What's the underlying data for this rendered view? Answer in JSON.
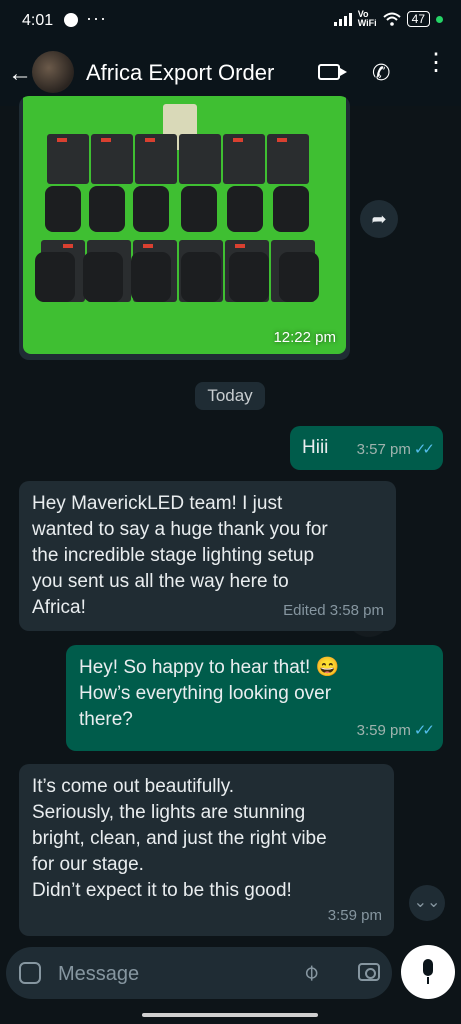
{
  "status_bar": {
    "time": "4:01",
    "dots": "···",
    "vowifi": "Vo\nWiFi",
    "battery": "47"
  },
  "header": {
    "title": "Africa Export Order"
  },
  "image_message": {
    "time": "12:22 pm"
  },
  "date_chip": "Today",
  "messages": [
    {
      "dir": "out",
      "text": "Hiii",
      "time": "3:57 pm"
    },
    {
      "dir": "in",
      "text": "Hey MaverickLED team! I just\nwanted to say a huge thank you for\nthe incredible stage lighting setup\nyou sent us  all the way here to\nAfrica!",
      "time": "Edited 3:58 pm"
    },
    {
      "dir": "out",
      "text": "Hey! So happy to hear that! 😄\nHow’s everything looking over\nthere?",
      "time": "3:59 pm"
    },
    {
      "dir": "in",
      "text": "It’s come out beautifully.\nSeriously, the lights are stunning\nbright, clean, and just the right vibe\nfor our stage.\nDidn’t expect it to be this good!",
      "time": "3:59 pm"
    }
  ],
  "composer": {
    "placeholder": "Message"
  },
  "colors": {
    "outgoing": "#005c4b",
    "incoming": "#202c33",
    "ticks": "#53bdeb",
    "photo_bg": "#3fbf32"
  },
  "icons": [
    "back-arrow-icon",
    "video-call-icon",
    "voice-call-icon",
    "menu-icon",
    "forward-icon",
    "scroll-down-icon",
    "emoji-icon",
    "attach-icon",
    "camera-icon",
    "mic-icon"
  ]
}
